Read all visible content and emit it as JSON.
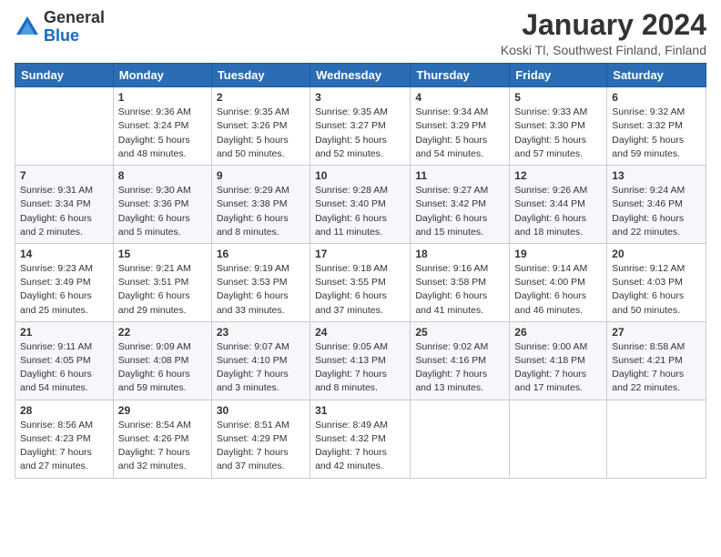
{
  "header": {
    "logo_general": "General",
    "logo_blue": "Blue",
    "month_year": "January 2024",
    "location": "Koski Tl, Southwest Finland, Finland"
  },
  "weekdays": [
    "Sunday",
    "Monday",
    "Tuesday",
    "Wednesday",
    "Thursday",
    "Friday",
    "Saturday"
  ],
  "weeks": [
    [
      {
        "day": "",
        "info": ""
      },
      {
        "day": "1",
        "info": "Sunrise: 9:36 AM\nSunset: 3:24 PM\nDaylight: 5 hours\nand 48 minutes."
      },
      {
        "day": "2",
        "info": "Sunrise: 9:35 AM\nSunset: 3:26 PM\nDaylight: 5 hours\nand 50 minutes."
      },
      {
        "day": "3",
        "info": "Sunrise: 9:35 AM\nSunset: 3:27 PM\nDaylight: 5 hours\nand 52 minutes."
      },
      {
        "day": "4",
        "info": "Sunrise: 9:34 AM\nSunset: 3:29 PM\nDaylight: 5 hours\nand 54 minutes."
      },
      {
        "day": "5",
        "info": "Sunrise: 9:33 AM\nSunset: 3:30 PM\nDaylight: 5 hours\nand 57 minutes."
      },
      {
        "day": "6",
        "info": "Sunrise: 9:32 AM\nSunset: 3:32 PM\nDaylight: 5 hours\nand 59 minutes."
      }
    ],
    [
      {
        "day": "7",
        "info": "Sunrise: 9:31 AM\nSunset: 3:34 PM\nDaylight: 6 hours\nand 2 minutes."
      },
      {
        "day": "8",
        "info": "Sunrise: 9:30 AM\nSunset: 3:36 PM\nDaylight: 6 hours\nand 5 minutes."
      },
      {
        "day": "9",
        "info": "Sunrise: 9:29 AM\nSunset: 3:38 PM\nDaylight: 6 hours\nand 8 minutes."
      },
      {
        "day": "10",
        "info": "Sunrise: 9:28 AM\nSunset: 3:40 PM\nDaylight: 6 hours\nand 11 minutes."
      },
      {
        "day": "11",
        "info": "Sunrise: 9:27 AM\nSunset: 3:42 PM\nDaylight: 6 hours\nand 15 minutes."
      },
      {
        "day": "12",
        "info": "Sunrise: 9:26 AM\nSunset: 3:44 PM\nDaylight: 6 hours\nand 18 minutes."
      },
      {
        "day": "13",
        "info": "Sunrise: 9:24 AM\nSunset: 3:46 PM\nDaylight: 6 hours\nand 22 minutes."
      }
    ],
    [
      {
        "day": "14",
        "info": "Sunrise: 9:23 AM\nSunset: 3:49 PM\nDaylight: 6 hours\nand 25 minutes."
      },
      {
        "day": "15",
        "info": "Sunrise: 9:21 AM\nSunset: 3:51 PM\nDaylight: 6 hours\nand 29 minutes."
      },
      {
        "day": "16",
        "info": "Sunrise: 9:19 AM\nSunset: 3:53 PM\nDaylight: 6 hours\nand 33 minutes."
      },
      {
        "day": "17",
        "info": "Sunrise: 9:18 AM\nSunset: 3:55 PM\nDaylight: 6 hours\nand 37 minutes."
      },
      {
        "day": "18",
        "info": "Sunrise: 9:16 AM\nSunset: 3:58 PM\nDaylight: 6 hours\nand 41 minutes."
      },
      {
        "day": "19",
        "info": "Sunrise: 9:14 AM\nSunset: 4:00 PM\nDaylight: 6 hours\nand 46 minutes."
      },
      {
        "day": "20",
        "info": "Sunrise: 9:12 AM\nSunset: 4:03 PM\nDaylight: 6 hours\nand 50 minutes."
      }
    ],
    [
      {
        "day": "21",
        "info": "Sunrise: 9:11 AM\nSunset: 4:05 PM\nDaylight: 6 hours\nand 54 minutes."
      },
      {
        "day": "22",
        "info": "Sunrise: 9:09 AM\nSunset: 4:08 PM\nDaylight: 6 hours\nand 59 minutes."
      },
      {
        "day": "23",
        "info": "Sunrise: 9:07 AM\nSunset: 4:10 PM\nDaylight: 7 hours\nand 3 minutes."
      },
      {
        "day": "24",
        "info": "Sunrise: 9:05 AM\nSunset: 4:13 PM\nDaylight: 7 hours\nand 8 minutes."
      },
      {
        "day": "25",
        "info": "Sunrise: 9:02 AM\nSunset: 4:16 PM\nDaylight: 7 hours\nand 13 minutes."
      },
      {
        "day": "26",
        "info": "Sunrise: 9:00 AM\nSunset: 4:18 PM\nDaylight: 7 hours\nand 17 minutes."
      },
      {
        "day": "27",
        "info": "Sunrise: 8:58 AM\nSunset: 4:21 PM\nDaylight: 7 hours\nand 22 minutes."
      }
    ],
    [
      {
        "day": "28",
        "info": "Sunrise: 8:56 AM\nSunset: 4:23 PM\nDaylight: 7 hours\nand 27 minutes."
      },
      {
        "day": "29",
        "info": "Sunrise: 8:54 AM\nSunset: 4:26 PM\nDaylight: 7 hours\nand 32 minutes."
      },
      {
        "day": "30",
        "info": "Sunrise: 8:51 AM\nSunset: 4:29 PM\nDaylight: 7 hours\nand 37 minutes."
      },
      {
        "day": "31",
        "info": "Sunrise: 8:49 AM\nSunset: 4:32 PM\nDaylight: 7 hours\nand 42 minutes."
      },
      {
        "day": "",
        "info": ""
      },
      {
        "day": "",
        "info": ""
      },
      {
        "day": "",
        "info": ""
      }
    ]
  ]
}
